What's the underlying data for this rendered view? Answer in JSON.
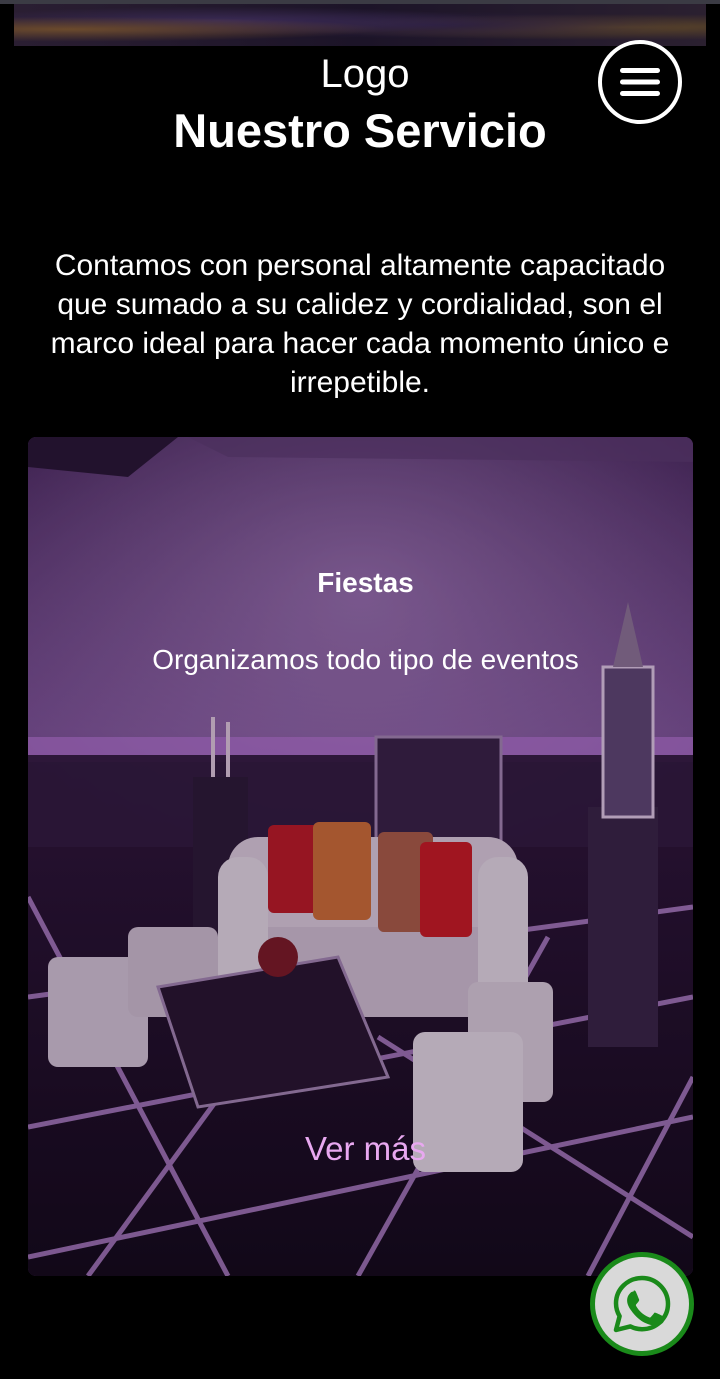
{
  "header": {
    "logo_text": "Logo",
    "section_title": "Nuestro Servicio",
    "menu_icon": "hamburger-menu-icon"
  },
  "intro": {
    "text": "Contamos con personal altamente capacitado que sumado a su calidez y cordialidad, son el marco ideal para hacer cada momento único e irrepetible."
  },
  "service_card": {
    "title": "Fiestas",
    "description": "Organizamos todo tipo de eventos",
    "link_label": "Ver más",
    "image_subject": "purple-lit-lounge-room"
  },
  "floating": {
    "whatsapp_icon": "whatsapp-icon"
  },
  "colors": {
    "background": "#000000",
    "text": "#ffffff",
    "link": "#e8a8f0",
    "whatsapp_ring": "#1a8a1a",
    "whatsapp_fill": "#d9d9d9"
  }
}
